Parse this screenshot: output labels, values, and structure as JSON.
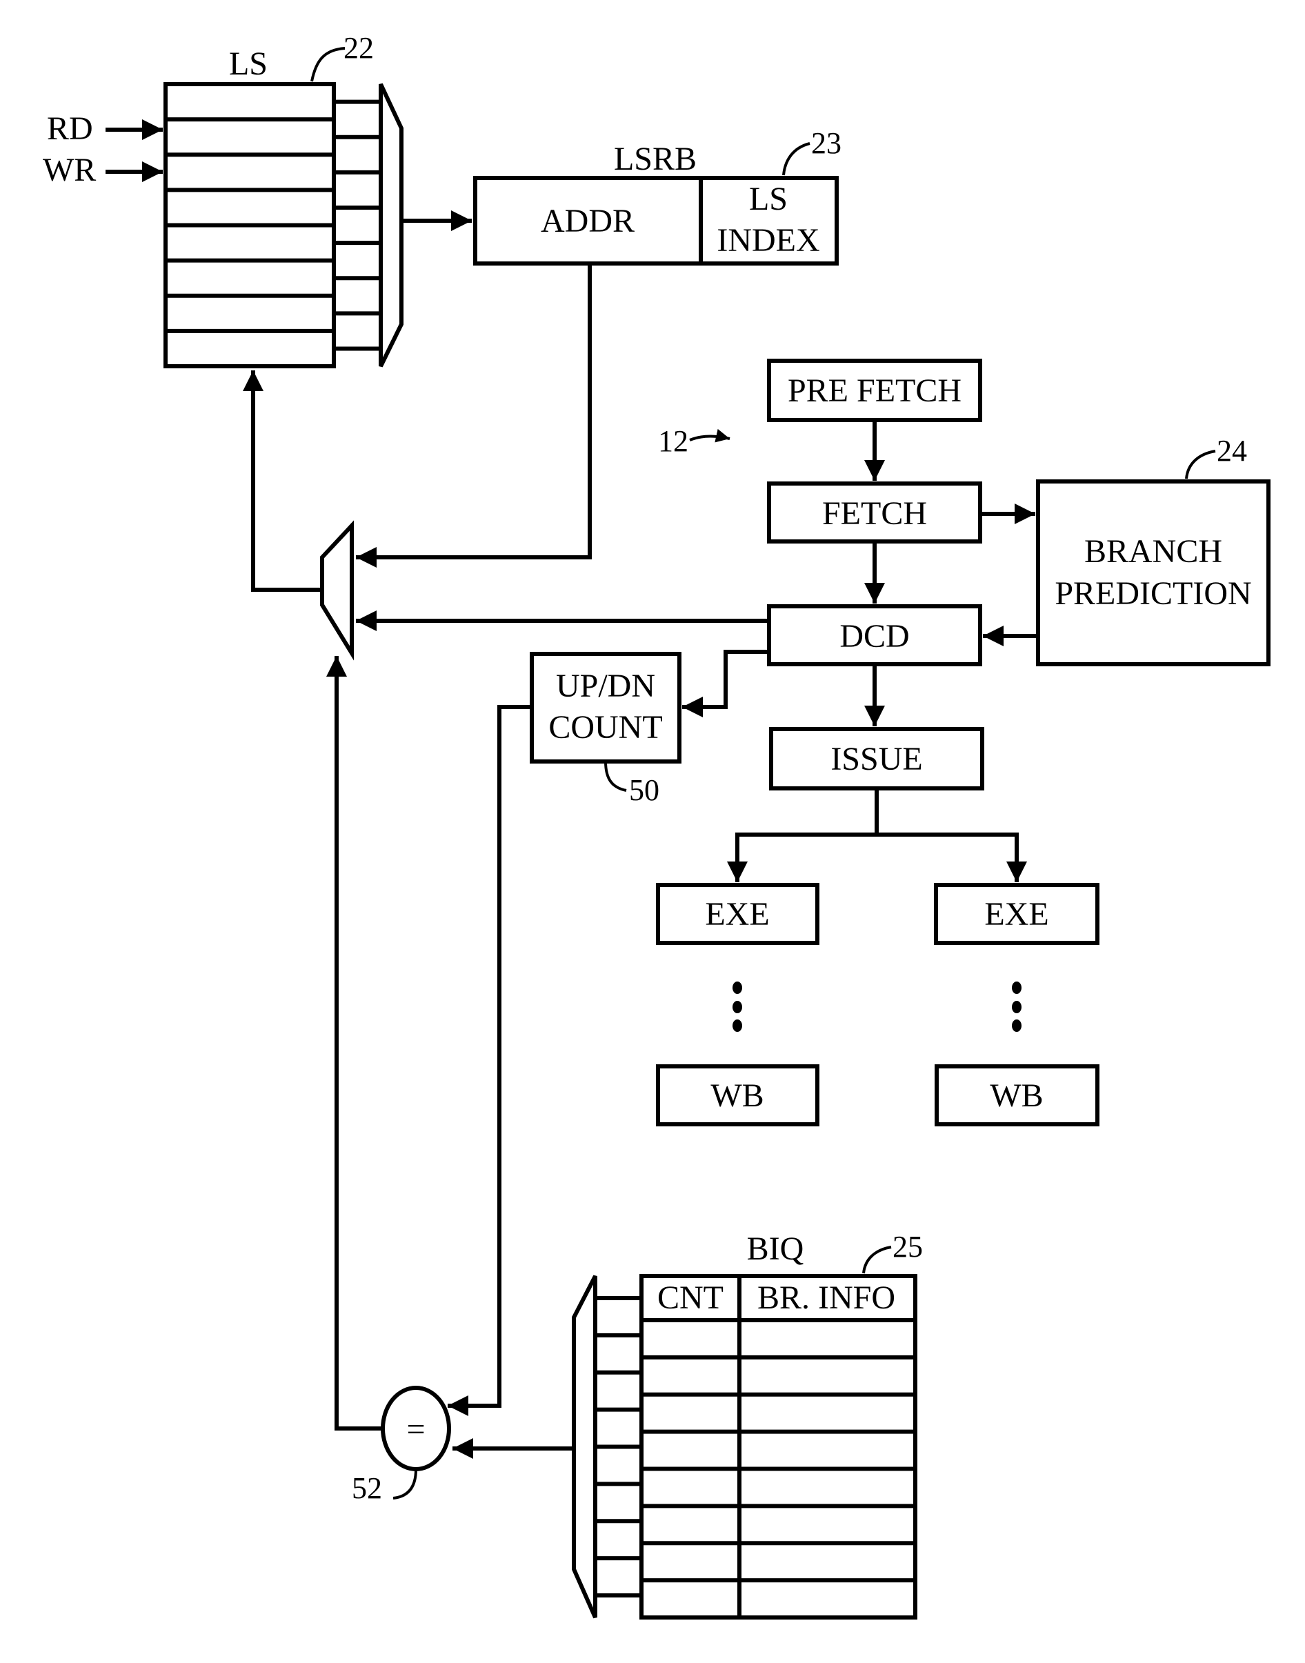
{
  "figure": {
    "reference_label": "12",
    "load_store": {
      "title": "LS",
      "ref": "22",
      "rows": 8,
      "inputs": [
        "RD",
        "WR"
      ]
    },
    "lsrb": {
      "title": "LSRB",
      "ref": "23",
      "addr_label": "ADDR",
      "index_label_line1": "LS",
      "index_label_line2": "INDEX"
    },
    "pipeline": {
      "prefetch": "PRE FETCH",
      "fetch": "FETCH",
      "decode": "DCD",
      "issue": "ISSUE",
      "exe_left": "EXE",
      "exe_right": "EXE",
      "wb_left": "WB",
      "wb_right": "WB"
    },
    "branch_prediction": {
      "ref": "24",
      "line1": "BRANCH",
      "line2": "PREDICTION"
    },
    "counter": {
      "ref": "50",
      "line1": "UP/DN",
      "line2": "COUNT"
    },
    "comparator": {
      "ref": "52",
      "symbol": "="
    },
    "biq": {
      "title": "BIQ",
      "ref": "25",
      "col_cnt": "CNT",
      "col_info": "BR. INFO",
      "rows": 8
    }
  }
}
